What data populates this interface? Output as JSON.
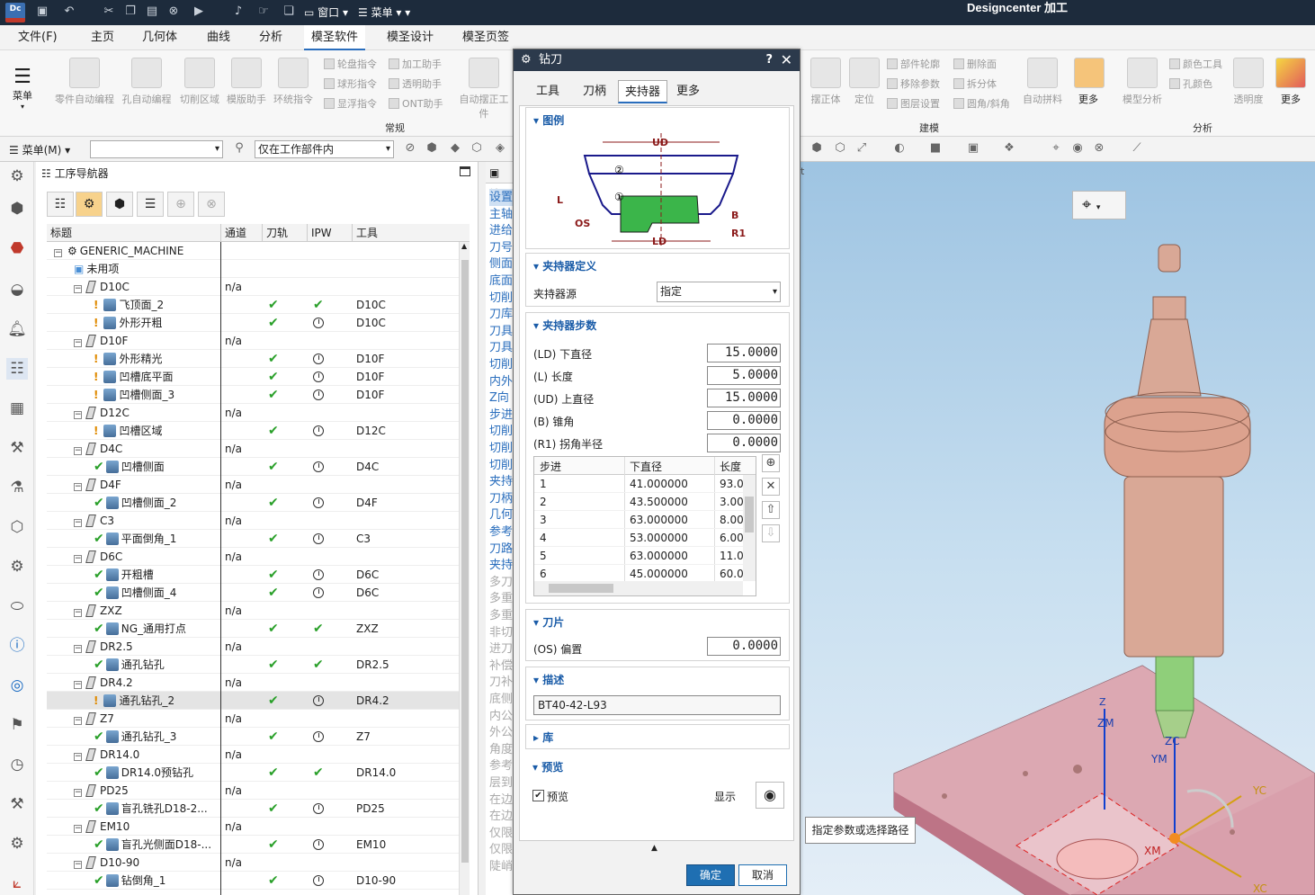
{
  "titlebar": {
    "app_name": "Designcenter  加工",
    "dc_logo": "Dc"
  },
  "menubar": {
    "tabs": [
      "文件(F)",
      "主页",
      "几何体",
      "曲线",
      "分析",
      "模圣软件",
      "模圣设计",
      "模圣页签"
    ],
    "active": "模圣软件"
  },
  "ribbon": {
    "menu_label": "菜单",
    "left_buttons": [
      "零件自动编程",
      "孔自动编程",
      "切削区域",
      "模版助手",
      "环统指令"
    ],
    "small_col1": [
      "轮盘指令",
      "球形指令",
      "显浮指令"
    ],
    "small_col2": [
      "加工助手",
      "透明助手",
      "ONT助手"
    ],
    "auto_button": "自动摆正工件",
    "group_left": "常规",
    "mid_buttons": [
      "摆正体",
      "定位"
    ],
    "small_col3": [
      "部件轮廓",
      "移除参数",
      "图层设置"
    ],
    "small_col4": [
      "删除面",
      "拆分体",
      "圆角/斜角"
    ],
    "auto2": "自动拼料",
    "more1": "更多",
    "group_mid": "建模",
    "model_analysis": "模型分析",
    "small_col5": [
      "颜色工具",
      "孔颜色"
    ],
    "transparency": "透明度",
    "more2": "更多",
    "group_right": "分析"
  },
  "toolbar2": {
    "menu_label": "菜单(M)",
    "filter_value": "",
    "scope_value": "仅在工作部件内"
  },
  "navigator": {
    "title": "工序导航器",
    "columns": [
      "标题",
      "通道",
      "刀轨",
      "IPW",
      "工具"
    ],
    "rows": [
      {
        "name": "GENERIC_MACHINE",
        "level": 0,
        "kind": "machine",
        "exp": "−",
        "chan": "",
        "path": "",
        "ipw": "",
        "tool": ""
      },
      {
        "name": "未用项",
        "level": 1,
        "kind": "folder",
        "exp": "",
        "chan": "",
        "path": "",
        "ipw": "",
        "tool": ""
      },
      {
        "name": "D10C",
        "level": 1,
        "kind": "tool",
        "exp": "−",
        "chan": "n/a",
        "path": "",
        "ipw": "",
        "tool": ""
      },
      {
        "name": "飞顶面_2",
        "level": 2,
        "kind": "op",
        "mark": "!",
        "chan": "",
        "path": "✔",
        "ipw": "✔",
        "tool": "D10C"
      },
      {
        "name": "外形开粗",
        "level": 2,
        "kind": "op",
        "mark": "!",
        "chan": "",
        "path": "✔",
        "ipw": "clock",
        "tool": "D10C"
      },
      {
        "name": "D10F",
        "level": 1,
        "kind": "tool",
        "exp": "−",
        "chan": "n/a",
        "path": "",
        "ipw": "",
        "tool": ""
      },
      {
        "name": "外形精光",
        "level": 2,
        "kind": "op",
        "mark": "!",
        "chan": "",
        "path": "✔",
        "ipw": "clock",
        "tool": "D10F"
      },
      {
        "name": "凹槽底平面",
        "level": 2,
        "kind": "op",
        "mark": "!",
        "chan": "",
        "path": "✔",
        "ipw": "clock",
        "tool": "D10F"
      },
      {
        "name": "凹槽侧面_3",
        "level": 2,
        "kind": "op",
        "mark": "!",
        "chan": "",
        "path": "✔",
        "ipw": "clock",
        "tool": "D10F"
      },
      {
        "name": "D12C",
        "level": 1,
        "kind": "tool",
        "exp": "−",
        "chan": "n/a",
        "path": "",
        "ipw": "",
        "tool": ""
      },
      {
        "name": "凹槽区域",
        "level": 2,
        "kind": "op",
        "mark": "!",
        "chan": "",
        "path": "✔",
        "ipw": "clock",
        "tool": "D12C"
      },
      {
        "name": "D4C",
        "level": 1,
        "kind": "tool",
        "exp": "−",
        "chan": "n/a",
        "path": "",
        "ipw": "",
        "tool": ""
      },
      {
        "name": "凹槽侧面",
        "level": 2,
        "kind": "op",
        "mark": "✔",
        "chan": "",
        "path": "✔",
        "ipw": "clock",
        "tool": "D4C"
      },
      {
        "name": "D4F",
        "level": 1,
        "kind": "tool",
        "exp": "−",
        "chan": "n/a",
        "path": "",
        "ipw": "",
        "tool": ""
      },
      {
        "name": "凹槽侧面_2",
        "level": 2,
        "kind": "op",
        "mark": "✔",
        "chan": "",
        "path": "✔",
        "ipw": "clock",
        "tool": "D4F"
      },
      {
        "name": "C3",
        "level": 1,
        "kind": "tool",
        "exp": "−",
        "chan": "n/a",
        "path": "",
        "ipw": "",
        "tool": ""
      },
      {
        "name": "平面倒角_1",
        "level": 2,
        "kind": "op",
        "mark": "✔",
        "chan": "",
        "path": "✔",
        "ipw": "clock",
        "tool": "C3"
      },
      {
        "name": "D6C",
        "level": 1,
        "kind": "tool",
        "exp": "−",
        "chan": "n/a",
        "path": "",
        "ipw": "",
        "tool": ""
      },
      {
        "name": "开粗槽",
        "level": 2,
        "kind": "op",
        "mark": "✔",
        "chan": "",
        "path": "✔",
        "ipw": "clock",
        "tool": "D6C"
      },
      {
        "name": "凹槽侧面_4",
        "level": 2,
        "kind": "op",
        "mark": "✔",
        "chan": "",
        "path": "✔",
        "ipw": "clock",
        "tool": "D6C"
      },
      {
        "name": "ZXZ",
        "level": 1,
        "kind": "tool",
        "exp": "−",
        "chan": "n/a",
        "path": "",
        "ipw": "",
        "tool": ""
      },
      {
        "name": "NG_通用打点",
        "level": 2,
        "kind": "op",
        "mark": "✔",
        "chan": "",
        "path": "✔",
        "ipw": "✔",
        "tool": "ZXZ"
      },
      {
        "name": "DR2.5",
        "level": 1,
        "kind": "tool",
        "exp": "−",
        "chan": "n/a",
        "path": "",
        "ipw": "",
        "tool": ""
      },
      {
        "name": "通孔钻孔",
        "level": 2,
        "kind": "op",
        "mark": "✔",
        "chan": "",
        "path": "✔",
        "ipw": "✔",
        "tool": "DR2.5"
      },
      {
        "name": "DR4.2",
        "level": 1,
        "kind": "tool",
        "exp": "−",
        "chan": "n/a",
        "path": "",
        "ipw": "",
        "tool": ""
      },
      {
        "name": "通孔钻孔_2",
        "level": 2,
        "kind": "op",
        "mark": "!",
        "chan": "",
        "path": "✔",
        "ipw": "clock",
        "tool": "DR4.2",
        "hl": true
      },
      {
        "name": "Z7",
        "level": 1,
        "kind": "tool",
        "exp": "−",
        "chan": "n/a",
        "path": "",
        "ipw": "",
        "tool": ""
      },
      {
        "name": "通孔钻孔_3",
        "level": 2,
        "kind": "op",
        "mark": "✔",
        "chan": "",
        "path": "✔",
        "ipw": "clock",
        "tool": "Z7"
      },
      {
        "name": "DR14.0",
        "level": 1,
        "kind": "tool",
        "exp": "−",
        "chan": "n/a",
        "path": "",
        "ipw": "",
        "tool": ""
      },
      {
        "name": "DR14.0预钻孔",
        "level": 2,
        "kind": "op",
        "mark": "✔",
        "chan": "",
        "path": "✔",
        "ipw": "✔",
        "tool": "DR14.0"
      },
      {
        "name": "PD25",
        "level": 1,
        "kind": "tool",
        "exp": "−",
        "chan": "n/a",
        "path": "",
        "ipw": "",
        "tool": ""
      },
      {
        "name": "盲孔铣孔D18-2...",
        "level": 2,
        "kind": "op",
        "mark": "✔",
        "chan": "",
        "path": "✔",
        "ipw": "clock",
        "tool": "PD25"
      },
      {
        "name": "EM10",
        "level": 1,
        "kind": "tool",
        "exp": "−",
        "chan": "n/a",
        "path": "",
        "ipw": "",
        "tool": ""
      },
      {
        "name": "盲孔光侧面D18-...",
        "level": 2,
        "kind": "op",
        "mark": "✔",
        "chan": "",
        "path": "✔",
        "ipw": "clock",
        "tool": "EM10"
      },
      {
        "name": "D10-90",
        "level": 1,
        "kind": "tool",
        "exp": "−",
        "chan": "n/a",
        "path": "",
        "ipw": "",
        "tool": ""
      },
      {
        "name": "钻倒角_1",
        "level": 2,
        "kind": "op",
        "mark": "✔",
        "chan": "",
        "path": "✔",
        "ipw": "clock",
        "tool": "D10-90"
      }
    ]
  },
  "midpanel": {
    "items": [
      "设置",
      "主轴",
      "进给",
      "刀号",
      "侧面",
      "底面",
      "切削",
      "刀库",
      "刀具",
      "刀具",
      "切削",
      "内外",
      "Z向",
      "步进",
      "切削",
      "切削",
      "切削",
      "夹持",
      "刀柄",
      "几何",
      "参考",
      "刀路",
      "夹持",
      "多刀",
      "多重",
      "多重",
      "非切",
      "进刀",
      "补偿",
      "刀补",
      "底侧",
      "内公",
      "外公",
      "角度",
      "参考",
      "层到",
      "在边",
      "在边",
      "仅限",
      "仅限",
      "陡峭"
    ],
    "dim_from": 23
  },
  "dialog": {
    "title": "钻刀",
    "help": "?",
    "tabs": [
      "工具",
      "刀柄",
      "夹持器",
      "更多"
    ],
    "active_tab": "夹持器",
    "legend_section": "图例",
    "legend_labels": {
      "ud": "UD",
      "ld": "LD",
      "l": "L",
      "os": "OS",
      "b": "B",
      "r1": "R1",
      "c1": "①",
      "c2": "②"
    },
    "holder_def_section": "夹持器定义",
    "holder_source_label": "夹持器源",
    "holder_source_value": "指定",
    "steps_section": "夹持器步数",
    "params": [
      {
        "label": "(LD) 下直径",
        "value": "15.0000"
      },
      {
        "label": "(L) 长度",
        "value": "5.0000"
      },
      {
        "label": "(UD) 上直径",
        "value": "15.0000"
      },
      {
        "label": "(B) 锥角",
        "value": "0.0000"
      },
      {
        "label": "(R1) 拐角半径",
        "value": "0.0000"
      }
    ],
    "step_table": {
      "headers": [
        "步进",
        "下直径",
        "长度"
      ],
      "rows": [
        [
          "1",
          "41.000000",
          "93.0"
        ],
        [
          "2",
          "43.500000",
          "3.00"
        ],
        [
          "3",
          "63.000000",
          "8.00"
        ],
        [
          "4",
          "53.000000",
          "6.00"
        ],
        [
          "5",
          "63.000000",
          "11.0"
        ],
        [
          "6",
          "45.000000",
          "60.0"
        ]
      ]
    },
    "blade_section": "刀片",
    "offset_label": "(OS) 偏置",
    "offset_value": "0.0000",
    "desc_section": "描述",
    "desc_value": "BT40-42-L93",
    "lib_section": "库",
    "preview_section": "预览",
    "preview_check_label": "预览",
    "show_label": "显示",
    "ok": "确定",
    "cancel": "取消"
  },
  "viewport": {
    "axis_labels": {
      "zm": "ZM",
      "zc": "ZC",
      "ym": "YM",
      "yc": "YC",
      "xm": "XM",
      "xc": "XC",
      "z": "Z"
    },
    "tooltip": "指定参数或选择路径"
  }
}
